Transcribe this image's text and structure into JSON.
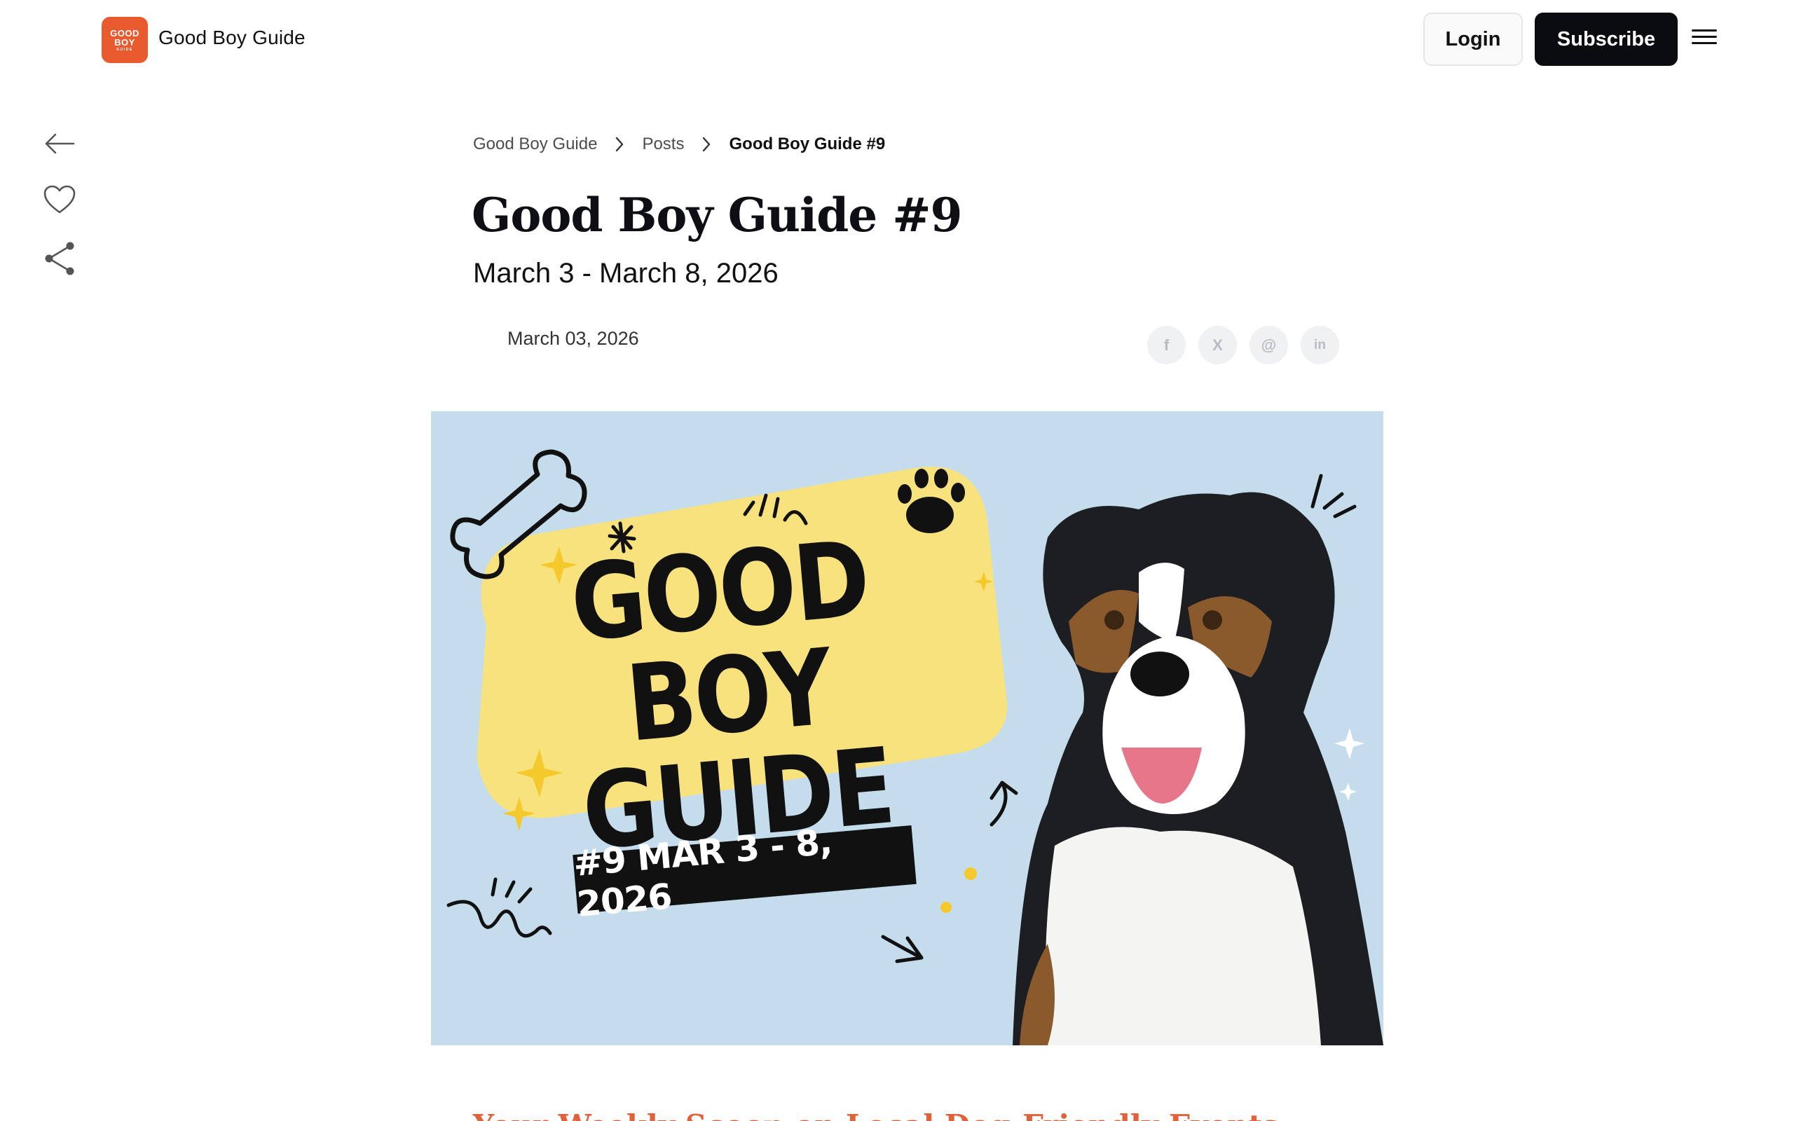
{
  "header": {
    "logo_text": [
      "GOOD",
      "BOY",
      "GUIDE"
    ],
    "site_name": "Good Boy Guide",
    "login_label": "Login",
    "subscribe_label": "Subscribe",
    "menu_icon": "hamburger-menu-icon"
  },
  "rail": {
    "icons": [
      "arrow-left-icon",
      "heart-icon",
      "share-icon"
    ]
  },
  "breadcrumb": {
    "items": [
      "Good Boy Guide",
      "Posts",
      "Good Boy Guide #9"
    ]
  },
  "article": {
    "title": "Good Boy Guide #9",
    "subtitle": "March 3 - March 8, 2026",
    "date": "March 03, 2026",
    "share_icons": [
      "facebook-icon",
      "x-icon",
      "threads-icon",
      "linkedin-icon"
    ],
    "share_glyphs": [
      "f",
      "X",
      "@",
      "in"
    ]
  },
  "hero": {
    "headline_line1": "GOOD BOY",
    "headline_line2": "GUIDE",
    "badge": "#9 MAR 3 - 8, 2026"
  },
  "section": {
    "heading": "Your Weekly Scoop on Local Dog-Friendly Events"
  },
  "colors": {
    "brand": "#ea5a2f",
    "hero_bg": "#c4dceb",
    "headline_pill": "#f8e27e",
    "heading_accent": "#e0613a",
    "button_dark": "#0b0c10"
  }
}
